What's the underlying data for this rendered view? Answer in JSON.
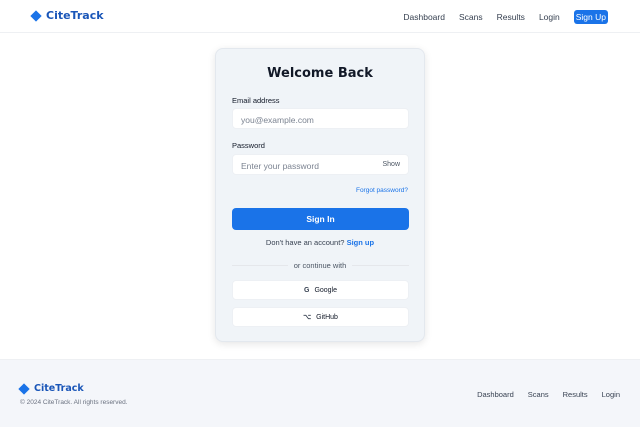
{
  "brand": {
    "name": "CiteTrack",
    "accent": "#1a73e8"
  },
  "header": {
    "nav": [
      "Dashboard",
      "Scans",
      "Results",
      "Login"
    ],
    "signup_label": "Sign Up"
  },
  "login": {
    "title": "Welcome Back",
    "email_label": "Email address",
    "email_placeholder": "you@example.com",
    "password_label": "Password",
    "password_placeholder": "Enter your password",
    "show_label": "Show",
    "forgot_label": "Forgot password?",
    "submit_label": "Sign In",
    "no_account_text": "Don't have an account?",
    "signup_link": "Sign up",
    "divider_text": "or continue with",
    "social": [
      {
        "label": "Google",
        "icon": "google-icon"
      },
      {
        "label": "GitHub",
        "icon": "github-icon"
      }
    ]
  },
  "footer": {
    "copyright": "© 2024 CiteTrack. All rights reserved.",
    "nav": [
      "Dashboard",
      "Scans",
      "Results",
      "Login"
    ]
  }
}
